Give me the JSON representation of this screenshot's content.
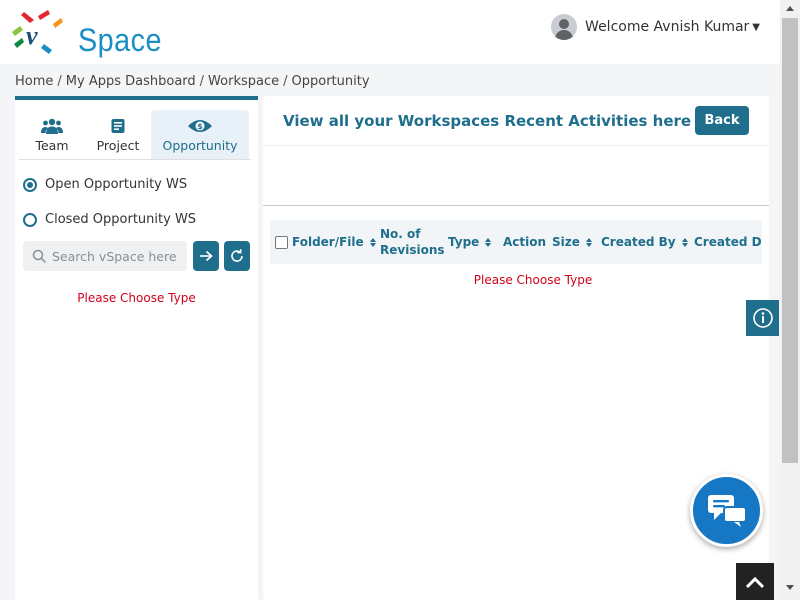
{
  "header": {
    "logo_text": "Space",
    "welcome_text": "Welcome Avnish Kumar"
  },
  "breadcrumb": [
    "Home",
    "My Apps Dashboard",
    "Workspace",
    "Opportunity"
  ],
  "left_panel": {
    "tabs": [
      {
        "label": "Team",
        "icon": "team-icon"
      },
      {
        "label": "Project",
        "icon": "project-icon"
      },
      {
        "label": "Opportunity",
        "icon": "eye-icon",
        "active": true
      }
    ],
    "radios": [
      {
        "label": "Open Opportunity WS",
        "checked": true
      },
      {
        "label": "Closed Opportunity WS",
        "checked": false
      }
    ],
    "search_placeholder": "Search vSpace here",
    "message": "Please Choose Type"
  },
  "right_panel": {
    "title": "View all your Workspaces Recent Activities here",
    "back_label": "Back",
    "columns": [
      "Folder/File",
      "No. of Revisions",
      "Type",
      "Action",
      "Size",
      "Created By",
      "Created Da"
    ],
    "message": "Please Choose Type"
  },
  "colors": {
    "accent": "#1f6e8c",
    "error": "#d0021b",
    "chat": "#1677c5"
  }
}
